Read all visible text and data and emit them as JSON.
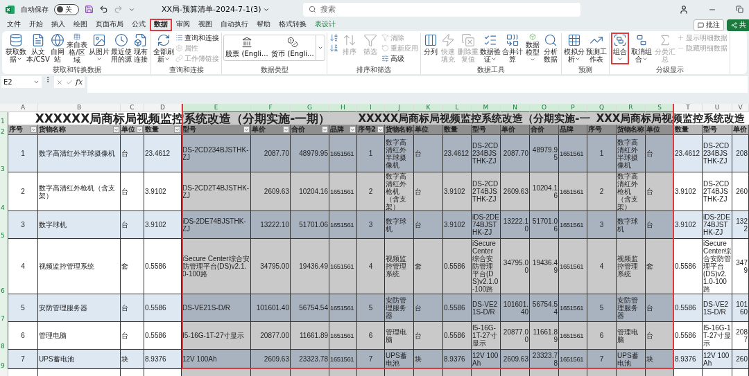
{
  "title_bar": {
    "autosave_label": "自动保存",
    "autosave_on": false,
    "toggle_text": "关",
    "document_title": "XX局-预算清单-2024-7-1(3)",
    "search_placeholder": "搜索"
  },
  "tabs": [
    {
      "label": "文件",
      "selected": false,
      "highlighted": false,
      "kind": "normal"
    },
    {
      "label": "开始",
      "selected": false,
      "highlighted": false,
      "kind": "normal"
    },
    {
      "label": "插入",
      "selected": false,
      "highlighted": false,
      "kind": "normal"
    },
    {
      "label": "绘图",
      "selected": false,
      "highlighted": false,
      "kind": "normal"
    },
    {
      "label": "页面布局",
      "selected": false,
      "highlighted": false,
      "kind": "normal"
    },
    {
      "label": "公式",
      "selected": false,
      "highlighted": false,
      "kind": "normal"
    },
    {
      "label": "数据",
      "selected": true,
      "highlighted": true,
      "kind": "normal"
    },
    {
      "label": "审阅",
      "selected": false,
      "highlighted": false,
      "kind": "normal"
    },
    {
      "label": "视图",
      "selected": false,
      "highlighted": false,
      "kind": "normal"
    },
    {
      "label": "自动执行",
      "selected": false,
      "highlighted": false,
      "kind": "normal"
    },
    {
      "label": "帮助",
      "selected": false,
      "highlighted": false,
      "kind": "normal"
    },
    {
      "label": "格式转换",
      "selected": false,
      "highlighted": false,
      "kind": "normal"
    },
    {
      "label": "表设计",
      "selected": false,
      "highlighted": false,
      "kind": "contextual"
    }
  ],
  "action_buttons": [
    {
      "label": "批注",
      "kind": "comment"
    },
    {
      "label": "共",
      "kind": "share"
    }
  ],
  "ribbon": {
    "groups": [
      {
        "title": "获取和转换数据",
        "items": [
          {
            "kind": "large",
            "label": "获取数据",
            "dropdown": true
          },
          {
            "kind": "large",
            "label": "从文本/CSV"
          },
          {
            "kind": "large",
            "label": "自网站"
          },
          {
            "kind": "large",
            "label": "来自表格/区域"
          },
          {
            "kind": "large",
            "label": "从图片",
            "dropdown": true
          },
          {
            "kind": "large",
            "label": "最近使用的源"
          },
          {
            "kind": "large",
            "label": "现有连接"
          }
        ]
      },
      {
        "title": "查询和连接",
        "items": [
          {
            "kind": "large",
            "label": "全部刷新",
            "dropdown": true
          },
          {
            "kind": "small",
            "label": "查询和连接"
          },
          {
            "kind": "small",
            "label": "属性",
            "disabled": true
          },
          {
            "kind": "small",
            "label": "工作簿链接",
            "disabled": true
          }
        ]
      },
      {
        "title": "数据类型",
        "items": [
          {
            "kind": "gallery",
            "options": [
              "股票 (Engli...",
              "货币 (Engli..."
            ]
          }
        ]
      },
      {
        "title": "排序和筛选",
        "items": [
          {
            "kind": "icon"
          },
          {
            "kind": "icon"
          },
          {
            "kind": "large",
            "label": "排序",
            "disabled": true
          },
          {
            "kind": "large",
            "label": "筛选",
            "disabled": true
          },
          {
            "kind": "small",
            "label": "清除",
            "disabled": true
          },
          {
            "kind": "small",
            "label": "重新应用",
            "disabled": true
          },
          {
            "kind": "small",
            "label": "高级"
          }
        ]
      },
      {
        "title": "数据工具",
        "items": [
          {
            "kind": "large",
            "label": "分列"
          },
          {
            "kind": "large",
            "label": "快速填充",
            "disabled": true
          },
          {
            "kind": "large",
            "label": "删除重复值",
            "disabled": true
          },
          {
            "kind": "large",
            "label": "数据验证",
            "dropdown": true
          },
          {
            "kind": "large",
            "label": "合并计算"
          },
          {
            "kind": "large",
            "label": "数据模型",
            "dropdown": true
          },
          {
            "kind": "large",
            "label": "分析数据"
          }
        ]
      },
      {
        "title": "预测",
        "items": [
          {
            "kind": "large",
            "label": "模拟分析",
            "dropdown": true
          },
          {
            "kind": "large",
            "label": "预测工作表"
          }
        ]
      },
      {
        "title": "分级显示",
        "items": [
          {
            "kind": "large",
            "label": "组合",
            "dropdown": true,
            "highlighted": true
          },
          {
            "kind": "large",
            "label": "取消组合",
            "dropdown": true
          },
          {
            "kind": "large",
            "label": "分类汇总",
            "disabled": true
          },
          {
            "kind": "small",
            "label": "显示明细数据",
            "disabled": true
          },
          {
            "kind": "small",
            "label": "隐藏明细数据",
            "disabled": true
          }
        ]
      }
    ]
  },
  "formula_bar": {
    "name_box": "E2",
    "function_label": "fx"
  },
  "sheet": {
    "selection_outlined": true,
    "columns": [
      {
        "letter": "A",
        "selected": false
      },
      {
        "letter": "B",
        "selected": false
      },
      {
        "letter": "C",
        "selected": false
      },
      {
        "letter": "D",
        "selected": false
      },
      {
        "letter": "E",
        "selected": true
      },
      {
        "letter": "F",
        "selected": true
      },
      {
        "letter": "G",
        "selected": true
      },
      {
        "letter": "H",
        "selected": true
      },
      {
        "letter": "I",
        "selected": true
      },
      {
        "letter": "J",
        "selected": true
      },
      {
        "letter": "K",
        "selected": true
      },
      {
        "letter": "L",
        "selected": true
      },
      {
        "letter": "M",
        "selected": true
      },
      {
        "letter": "N",
        "selected": true
      },
      {
        "letter": "O",
        "selected": true
      },
      {
        "letter": "P",
        "selected": true
      },
      {
        "letter": "Q",
        "selected": true
      },
      {
        "letter": "R",
        "selected": true
      },
      {
        "letter": "S",
        "selected": true
      },
      {
        "letter": "T",
        "selected": false
      },
      {
        "letter": "U",
        "selected": false
      },
      {
        "letter": "V",
        "selected": false
      }
    ],
    "titles": [
      "XXXXXX局商标局视频监控系统改造（分期实施-一期）",
      "XXXXX局商标局视频监控系统改造（分期实施-一",
      "XXX局商标局视频监控系统改造"
    ],
    "title_row": {
      "number": "1",
      "selected": true
    },
    "header_row": {
      "number": "2",
      "selected": true,
      "headers": [
        {
          "label": "序号",
          "filter": true
        },
        {
          "label": "货物名称",
          "filter": true
        },
        {
          "label": "单位",
          "filter": true
        },
        {
          "label": "数量",
          "filter": true
        },
        {
          "label": "型号",
          "filter": true
        },
        {
          "label": "单价",
          "filter": true
        },
        {
          "label": "合价",
          "filter": true
        },
        {
          "label": "品牌",
          "filter": true
        },
        {
          "label": "序号2",
          "filter": true
        },
        {
          "label": "货物名称",
          "filter": false
        },
        {
          "label": "单位",
          "filter": false
        },
        {
          "label": "数量",
          "filter": false
        },
        {
          "label": "型号",
          "filter": false
        },
        {
          "label": "单价",
          "filter": false
        },
        {
          "label": "合价",
          "filter": false
        },
        {
          "label": "品牌",
          "filter": false
        },
        {
          "label": "序号",
          "filter": false
        },
        {
          "label": "货物名称",
          "filter": false
        },
        {
          "label": "单位",
          "filter": false
        },
        {
          "label": "数量",
          "filter": false
        },
        {
          "label": "型号",
          "filter": false
        },
        {
          "label": "单价",
          "filter": false
        }
      ]
    },
    "rows": [
      {
        "number": "3",
        "selected": true,
        "banded": true,
        "cells": [
          "1",
          "数字高清红外半球摄像机",
          "台",
          "23.4612",
          "DS-2CD234BJSTHK-ZJ",
          "2087.70",
          "48979.95",
          "1651561",
          "1",
          "数字高清红外半球摄像机",
          "台",
          "23.4612",
          "DS-2CD234BJSTHK-ZJ",
          "2087.70",
          "48979.95",
          "1651561",
          "1",
          "数字高清红外半球摄像机",
          "台",
          "23.4612",
          "DS-2CD234BJSTHK-ZJ",
          "208"
        ]
      },
      {
        "number": "4",
        "selected": true,
        "banded": false,
        "cells": [
          "2",
          "数字高清红外枪机（含支架）",
          "台",
          "3.9102",
          "DS-2CD2T4BJSTHK-ZJ",
          "2609.63",
          "10204.16",
          "1651561",
          "2",
          "数字高清红外枪机（含支架）",
          "台",
          "3.9102",
          "DS-2CD2T4BJSTHK-ZJ",
          "2609.63",
          "10204.16",
          "1651561",
          "2",
          "数字高清红外枪机（含支架）",
          "台",
          "3.9102",
          "DS-2CD2T4BJSTHK-ZJ",
          "260"
        ]
      },
      {
        "number": "5",
        "selected": true,
        "banded": true,
        "cells": [
          "3",
          "数字球机",
          "台",
          "3.9102",
          "iDS-2DE74BJSTHK-ZJ",
          "13222.10",
          "51701.06",
          "1651561",
          "3",
          "数字球机",
          "台",
          "3.9102",
          "iDS-2DE74BJSTHK-ZJ",
          "13222.10",
          "51701.06",
          "1651561",
          "3",
          "数字球机",
          "台",
          "3.9102",
          "iDS-2DE74BJSTHK-ZJ",
          "1322"
        ]
      },
      {
        "number": "6",
        "selected": true,
        "banded": false,
        "cells": [
          "4",
          "视频监控管理系统",
          "套",
          "0.5586",
          "iSecure Center综合安防管理平台(DS)v2.1.0-100路",
          "34795.00",
          "19436.49",
          "1651561",
          "4",
          "视频监控管理系统",
          "套",
          "0.5586",
          "iSecure Center综合安防管理平台(DS)v2.1.0-100路",
          "34795.00",
          "19436.49",
          "1651561",
          "4",
          "视频监控管理系统",
          "套",
          "0.5586",
          "iSecure Center综合安防管理平台(DS)v2.1.0-100路",
          "3479"
        ]
      },
      {
        "number": "7",
        "selected": true,
        "banded": true,
        "cells": [
          "5",
          "安防管理服务器",
          "台",
          "0.5586",
          "DS-VE21S-D/R",
          "101601.40",
          "56754.54",
          "1651561",
          "5",
          "安防管理服务器",
          "台",
          "0.5586",
          "DS-VE21S-D/R",
          "101601.40",
          "56754.54",
          "1651561",
          "5",
          "安防管理服务器",
          "台",
          "0.5586",
          "DS-VE21S-D/R",
          "10160"
        ]
      },
      {
        "number": "8",
        "selected": true,
        "banded": false,
        "cells": [
          "6",
          "管理电脑",
          "台",
          "0.5586",
          "I5-16G-1T-27寸显示",
          "20877.00",
          "11661.89",
          "1651561",
          "6",
          "管理电脑",
          "台",
          "0.5586",
          "I5-16G-1T-27寸显示",
          "20877.00",
          "11661.89",
          "1651561",
          "6",
          "管理电脑",
          "台",
          "0.5586",
          "I5-16G-1T-27寸显示",
          "2087"
        ]
      },
      {
        "number": "9",
        "selected": true,
        "banded": true,
        "cells": [
          "7",
          "UPS蓄电池",
          "块",
          "8.9376",
          "12V 100Ah",
          "2609.63",
          "23323.78",
          "1651561",
          "7",
          "UPS蓄电池",
          "块",
          "8.9376",
          "12V 100Ah",
          "2609.63",
          "23323.78",
          "1651561",
          "7",
          "UPS蓄电池",
          "块",
          "8.9376",
          "12V 100Ah",
          "260"
        ]
      }
    ]
  }
}
